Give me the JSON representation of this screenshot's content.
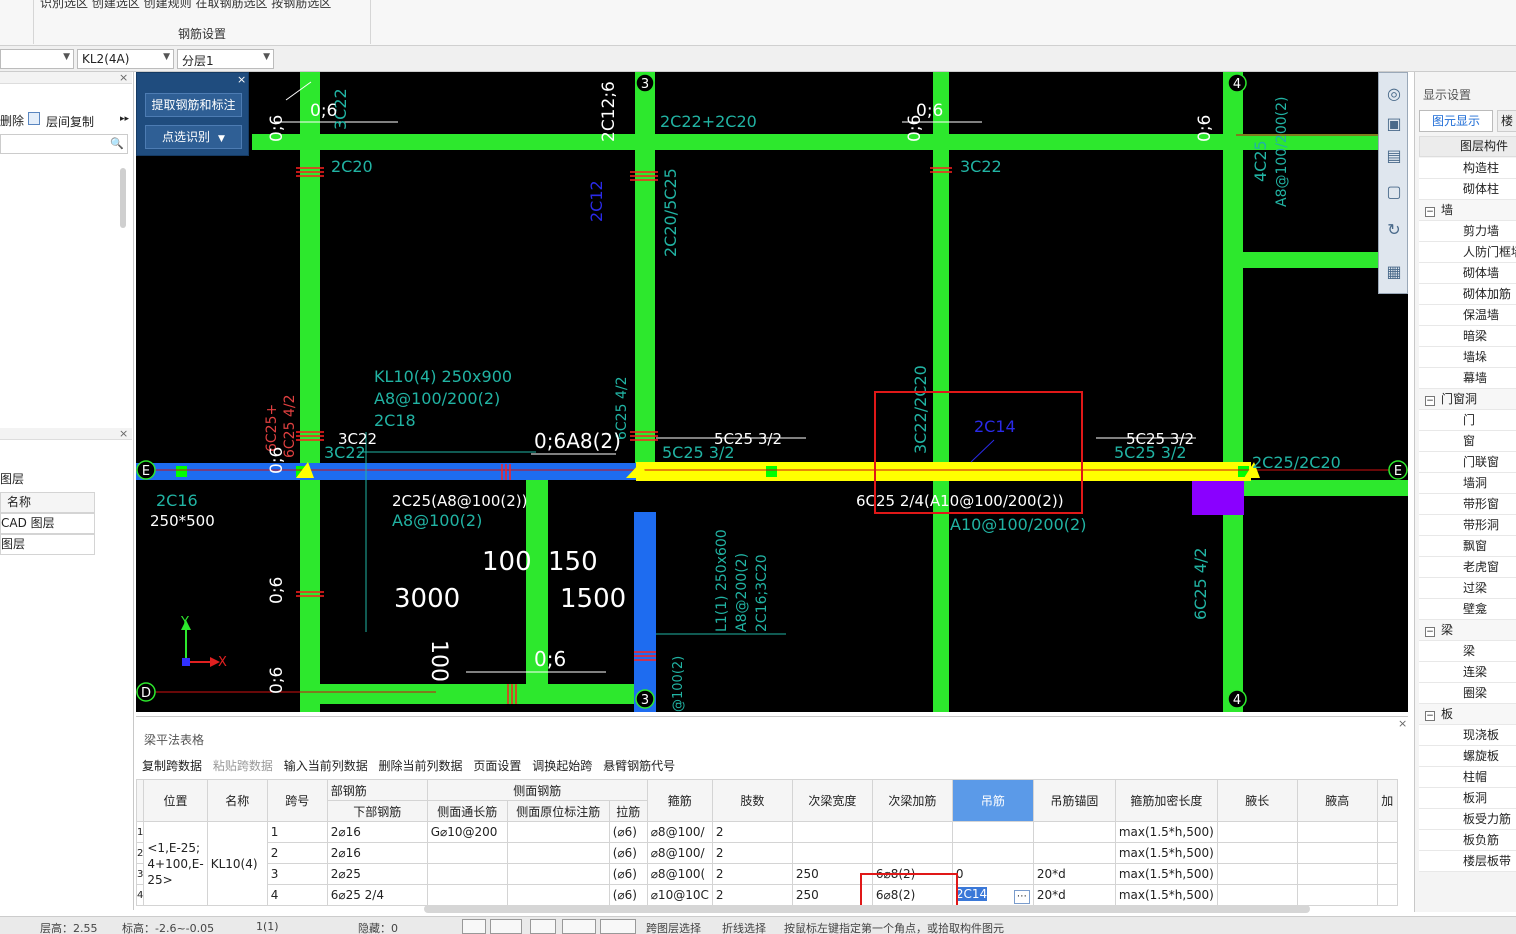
{
  "ribbon": {
    "group_label": "钢筋设置",
    "top_cut_text": "识別选区 创建选区 创建规则 在取钢筋选区 按钢筋选区"
  },
  "toolbar2": {
    "combo1": "",
    "combo2": "KL2(4A)",
    "combo3": "分层1"
  },
  "left_panel": {
    "delete_label": "删除",
    "floor_copy_label": "层间复制",
    "layer_title": "图层",
    "name_header": "名称",
    "cad_layer": "CAD 图层",
    "layer": "图层"
  },
  "float_panel": {
    "extract_btn": "提取钢筋和标注",
    "click_recognize_btn": "点选识别"
  },
  "cad": {
    "axis_labels": [
      "3",
      "4",
      "E",
      "E",
      "D",
      "3",
      "4"
    ],
    "texts": {
      "t_3c22_top": "3C22",
      "t_2c20_top": "2C20",
      "t_2c12_6": "2C12;6",
      "t_2c22_2c20": "2C22+2C20",
      "t_2c12": "2C12",
      "t_2c20_5c25": "2C20/5C25",
      "t_3c22_mid": "3C22",
      "t_06a": "0;6",
      "t_06b": "0;6",
      "t_06c": "0;6",
      "t_06d": "0;6",
      "t_4c25": "4C25",
      "t_a8_200": "A8@100/200(2)",
      "t_kl10": "KL10(4) 250x900",
      "t_kl10_stir": "A8@100/200(2)",
      "t_kl10_2c18": "2C18",
      "t_3c22_left": "3C22",
      "t_3c22_left2": "3C22",
      "t_06a8": "0;6A8(2)",
      "t_5c25_32": "5C25 3/2",
      "t_5c25_32b": "5C25 3/2",
      "t_5c25_32c": "5C25 3/2",
      "t_5c25_32d": "5C25 3/2",
      "t_3c22_2c20": "3C22/2C20",
      "t_2c14": "2C14",
      "t_2c25_2c20": "2C25/2C20",
      "t_2c16": "2C16",
      "t_250x500": "250*500",
      "t_2c25a8": "2C25(A8@100(2))",
      "t_a8_100": "A8@100(2)",
      "t_6c25": "6C25 2/4(A10@100/200(2))",
      "t_a10": "A10@100/200(2)",
      "t_100": "100",
      "t_150": "150",
      "t_3000": "3000",
      "t_1500": "1500",
      "t_100b": "100",
      "t_06e": "0;6",
      "t_06f": "0;6",
      "t_06g": "0;6",
      "t_l1": "L1(1) 250x600",
      "t_l1b": "A8@200(2)",
      "t_l1c": "2C16;3C20",
      "t_6c25_42": "6C25 4/2",
      "t_6c25_left": "6C25+",
      "t_6c25_left2": "6C25 4/2",
      "t_6c25_mid": "6C25 4/2",
      "t_a100": "@100(2)",
      "t_06h": "0;6",
      "t_06i": "0;6",
      "t_x": "X",
      "t_y": "Y"
    }
  },
  "right_panel": {
    "title": "显示设置",
    "tab1": "图元显示",
    "tab2": "楼",
    "header": "图层构件",
    "items": [
      {
        "label": "构造柱",
        "grp": false
      },
      {
        "label": "砌体柱",
        "grp": false
      },
      {
        "label": "墙",
        "grp": true
      },
      {
        "label": "剪力墙",
        "grp": false
      },
      {
        "label": "人防门框墙",
        "grp": false
      },
      {
        "label": "砌体墙",
        "grp": false
      },
      {
        "label": "砌体加筋",
        "grp": false
      },
      {
        "label": "保温墙",
        "grp": false
      },
      {
        "label": "暗梁",
        "grp": false
      },
      {
        "label": "墙垛",
        "grp": false
      },
      {
        "label": "幕墙",
        "grp": false
      },
      {
        "label": "门窗洞",
        "grp": true
      },
      {
        "label": "门",
        "grp": false
      },
      {
        "label": "窗",
        "grp": false
      },
      {
        "label": "门联窗",
        "grp": false
      },
      {
        "label": "墙洞",
        "grp": false
      },
      {
        "label": "带形窗",
        "grp": false
      },
      {
        "label": "带形洞",
        "grp": false
      },
      {
        "label": "飘窗",
        "grp": false
      },
      {
        "label": "老虎窗",
        "grp": false
      },
      {
        "label": "过梁",
        "grp": false
      },
      {
        "label": "壁龛",
        "grp": false
      },
      {
        "label": "梁",
        "grp": true
      },
      {
        "label": "梁",
        "grp": false
      },
      {
        "label": "连梁",
        "grp": false
      },
      {
        "label": "圈梁",
        "grp": false
      },
      {
        "label": "板",
        "grp": true
      },
      {
        "label": "现浇板",
        "grp": false
      },
      {
        "label": "螺旋板",
        "grp": false
      },
      {
        "label": "柱帽",
        "grp": false
      },
      {
        "label": "板洞",
        "grp": false
      },
      {
        "label": "板受力筋",
        "grp": false
      },
      {
        "label": "板负筋",
        "grp": false
      },
      {
        "label": "楼层板带",
        "grp": false
      }
    ]
  },
  "bottom_panel": {
    "title": "梁平法表格",
    "tools": [
      "复制跨数据",
      "粘贴跨数据",
      "输入当前列数据",
      "删除当前列数据",
      "页面设置",
      "调换起始跨",
      "悬臂钢筋代号"
    ],
    "header_top": {
      "bu": "部钢筋",
      "side": "侧面钢筋"
    },
    "headers": {
      "pos": "位置",
      "name": "名称",
      "span": "跨号",
      "bottom": "下部钢筋",
      "side_through": "侧面通长筋",
      "side_orig": "侧面原位标注筋",
      "tie": "拉筋",
      "stirrup": "箍筋",
      "legs": "肢数",
      "sec_width": "次梁宽度",
      "sec_add": "次梁加筋",
      "hanger": "吊筋",
      "hanger_anchor": "吊筋锚固",
      "dense_len": "箍筋加密长度",
      "haunch_len": "腋长",
      "haunch_h": "腋高",
      "add": "加"
    },
    "rows": [
      {
        "rn": "1",
        "span": "1",
        "bottom": "2⌀16",
        "side_through": "G⌀10@200",
        "side_orig": "",
        "tie": "(⌀6)",
        "stirrup": "⌀8@100/",
        "legs": "2",
        "sec_width": "",
        "sec_add": "",
        "hanger": "",
        "anchor": "",
        "dense": "max(1.5*h,500)"
      },
      {
        "rn": "2",
        "span": "2",
        "bottom": "2⌀16",
        "side_through": "",
        "side_orig": "",
        "tie": "(⌀6)",
        "stirrup": "⌀8@100/",
        "legs": "2",
        "sec_width": "",
        "sec_add": "",
        "hanger": "",
        "anchor": "",
        "dense": "max(1.5*h,500)"
      },
      {
        "rn": "3",
        "span": "3",
        "bottom": "2⌀25",
        "side_through": "",
        "side_orig": "",
        "tie": "(⌀6)",
        "stirrup": "⌀8@100(",
        "legs": "2",
        "sec_width": "250",
        "sec_add": "6⌀8(2)",
        "hanger": "0",
        "anchor": "20*d",
        "dense": "max(1.5*h,500)"
      },
      {
        "rn": "4",
        "span": "4",
        "bottom": "6⌀25 2/4",
        "side_through": "",
        "side_orig": "",
        "tie": "(⌀6)",
        "stirrup": "⌀10@10C",
        "legs": "2",
        "sec_width": "250",
        "sec_add": "6⌀8(2)",
        "hanger": "2C14",
        "anchor": "20*d",
        "dense": "max(1.5*h,500)"
      }
    ],
    "position_value": "<1,E-25;\n4+100,E-\n25>",
    "name_value": "KL10(4)"
  },
  "status": {
    "floor_height": "层高：2.55",
    "elevation": "标高：-2.6~-0.05",
    "count": "1(1)",
    "hidden": "隐藏：0",
    "cross_select": "跨图层选择",
    "polyline_select": "折线选择",
    "hint": "按鼠标左键指定第一个角点，或拾取构件图元"
  }
}
